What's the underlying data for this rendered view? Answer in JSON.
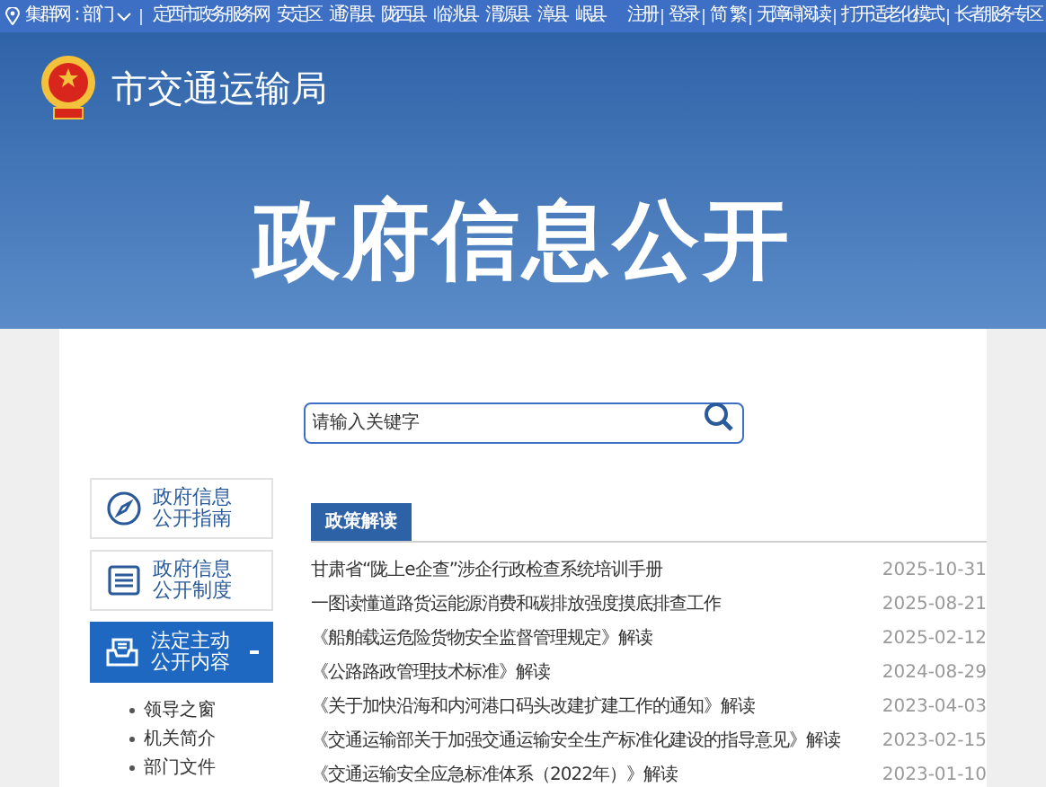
{
  "top_bar": {
    "location": "集群网：部门",
    "links": [
      "定西市政务服务网",
      "安定区",
      "通渭县",
      "陇西县",
      "临洮县",
      "渭源县",
      "漳县",
      "岷县"
    ],
    "right_links": [
      "注册",
      "登录",
      "简",
      "繁",
      "无障碍阅读",
      "打开适老化模式",
      "长者服务专区"
    ]
  },
  "header": {
    "site_name": "市交通运输局",
    "title": "政府信息公开"
  },
  "search": {
    "placeholder": "请输入关键字"
  },
  "nav": [
    {
      "label": "政府信息公开指南",
      "selected": false
    },
    {
      "label": "政府信息公开制度",
      "selected": false
    },
    {
      "label": "法定主动公开内容",
      "selected": true,
      "expanded": true,
      "children": [
        "领导之窗",
        "机关简介",
        "部门文件"
      ]
    }
  ],
  "section": {
    "tab": "政策解读",
    "items": [
      {
        "title": "甘肃省“陇上e企查”涉企行政检查系统培训手册",
        "date": "2025-10-31"
      },
      {
        "title": "一图读懂道路货运能源消费和碳排放强度摸底排查工作",
        "date": "2025-08-21"
      },
      {
        "title": "《船舶载运危险货物安全监督管理规定》解读",
        "date": "2025-02-12"
      },
      {
        "title": "《公路路政管理技术标准》解读",
        "date": "2024-08-29"
      },
      {
        "title": "《关于加快沿海和内河港口码头改建扩建工作的通知》解读",
        "date": "2023-04-03"
      },
      {
        "title": "《交通运输部关于加强交通运输安全生产标准化建设的指导意见》解读",
        "date": "2023-02-15"
      },
      {
        "title": "《交通运输安全应急标准体系（2022年）》解读",
        "date": "2023-01-10"
      }
    ]
  }
}
